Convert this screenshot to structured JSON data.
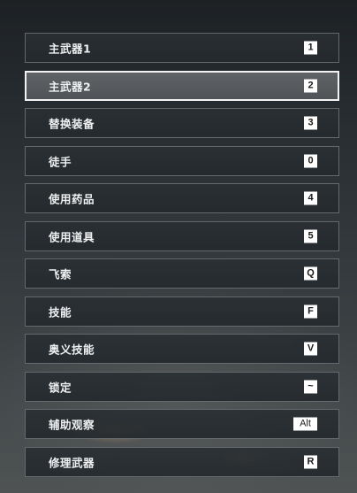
{
  "keybindings": [
    {
      "name": "primary-weapon-1",
      "label": "主武器1",
      "key": "1",
      "selected": false
    },
    {
      "name": "primary-weapon-2",
      "label": "主武器2",
      "key": "2",
      "selected": true
    },
    {
      "name": "swap-equipment",
      "label": "替换装备",
      "key": "3",
      "selected": false
    },
    {
      "name": "unarmed",
      "label": "徒手",
      "key": "0",
      "selected": false
    },
    {
      "name": "use-medicine",
      "label": "使用药品",
      "key": "4",
      "selected": false
    },
    {
      "name": "use-item",
      "label": "使用道具",
      "key": "5",
      "selected": false
    },
    {
      "name": "grappling-hook",
      "label": "飞索",
      "key": "Q",
      "selected": false
    },
    {
      "name": "skill",
      "label": "技能",
      "key": "F",
      "selected": false
    },
    {
      "name": "ultimate-skill",
      "label": "奥义技能",
      "key": "V",
      "selected": false
    },
    {
      "name": "lock-on",
      "label": "锁定",
      "key": "~",
      "selected": false
    },
    {
      "name": "assist-observe",
      "label": "辅助观察",
      "key": "Alt",
      "selected": false
    },
    {
      "name": "repair-weapon",
      "label": "修理武器",
      "key": "R",
      "selected": false
    }
  ]
}
